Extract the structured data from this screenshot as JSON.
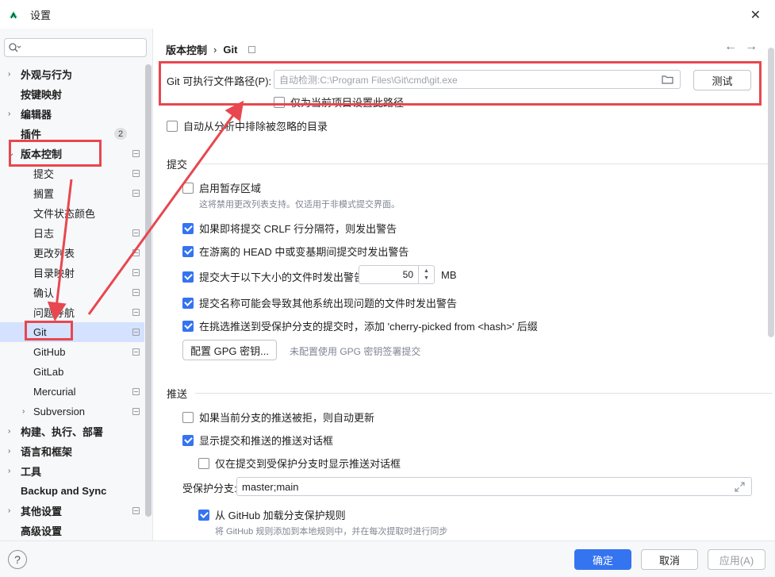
{
  "window": {
    "title": "设置"
  },
  "sidebar": {
    "search_placeholder": "",
    "items": [
      {
        "label": "外观与行为",
        "bold": true
      },
      {
        "label": "按键映射",
        "bold": true
      },
      {
        "label": "编辑器",
        "bold": true
      },
      {
        "label": "插件",
        "bold": true,
        "badge": "2"
      },
      {
        "label": "版本控制",
        "bold": true
      },
      {
        "label": "提交"
      },
      {
        "label": "搁置"
      },
      {
        "label": "文件状态颜色"
      },
      {
        "label": "日志"
      },
      {
        "label": "更改列表"
      },
      {
        "label": "目录映射"
      },
      {
        "label": "确认"
      },
      {
        "label": "问题导航"
      },
      {
        "label": "Git"
      },
      {
        "label": "GitHub"
      },
      {
        "label": "GitLab"
      },
      {
        "label": "Mercurial"
      },
      {
        "label": "Subversion"
      },
      {
        "label": "构建、执行、部署",
        "bold": true
      },
      {
        "label": "语言和框架",
        "bold": true
      },
      {
        "label": "工具",
        "bold": true
      },
      {
        "label": "Backup and Sync",
        "bold": true
      },
      {
        "label": "其他设置",
        "bold": true
      },
      {
        "label": "高级设置",
        "bold": true
      }
    ]
  },
  "breadcrumb": {
    "parent": "版本控制",
    "separator": "›",
    "current": "Git"
  },
  "git_path": {
    "label": "Git 可执行文件路径(P):",
    "placeholder": "自动检测:C:\\Program Files\\Git\\cmd\\git.exe",
    "test_button": "测试",
    "project_only": "仅为当前项目设置此路径"
  },
  "auto_ignore": "自动从分析中排除被忽略的目录",
  "commit_section": {
    "title": "提交",
    "staging": "启用暂存区域",
    "staging_hint": "这将禁用更改列表支持。仅适用于非模式提交界面。",
    "crlf": "如果即将提交 CRLF 行分隔符，则发出警告",
    "detached_head": "在游离的 HEAD 中或变基期间提交时发出警告",
    "large_files": "提交大于以下大小的文件时发出警告:",
    "large_files_value": "50",
    "large_files_unit": "MB",
    "bad_names": "提交名称可能会导致其他系统出现问题的文件时发出警告",
    "cherry_pick": "在挑选推送到受保护分支的提交时，添加 'cherry-picked from <hash>' 后缀",
    "gpg_button": "配置 GPG 密钥...",
    "gpg_hint": "未配置使用 GPG 密钥签署提交"
  },
  "push_section": {
    "title": "推送",
    "auto_update": "如果当前分支的推送被拒，则自动更新",
    "show_dialog": "显示提交和推送的推送对话框",
    "protected_only": "仅在提交到受保护分支时显示推送对话框",
    "protected_label": "受保护分支:",
    "protected_value": "master;main",
    "load_github": "从 GitHub 加载分支保护规则",
    "load_github_hint": "将 GitHub 规则添加到本地规则中，并在每次提取时进行同步"
  },
  "footer": {
    "ok": "确定",
    "cancel": "取消",
    "apply": "应用(A)",
    "help": "?"
  },
  "colors": {
    "accent": "#3574f0",
    "annotation": "#e8474f",
    "selection": "#d4e2ff"
  }
}
